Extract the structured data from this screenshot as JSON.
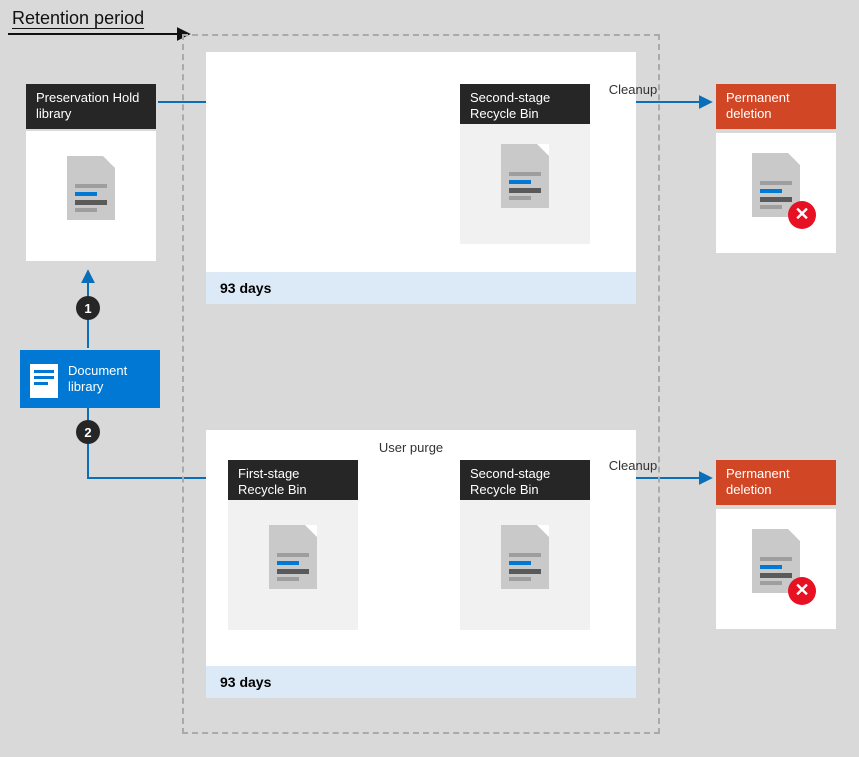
{
  "title": "Retention period",
  "source": {
    "preservationHold": "Preservation Hold library",
    "documentLibrary": "Document library"
  },
  "badges": {
    "one": "1",
    "two": "2"
  },
  "path1": {
    "secondStage": "Second-stage Recycle Bin",
    "cleanup": "Cleanup",
    "permanentDeletion": "Permanent deletion",
    "days": "93 days"
  },
  "path2": {
    "firstStage": "First-stage Recycle Bin",
    "userPurge": "User purge",
    "secondStage": "Second-stage Recycle Bin",
    "cleanup": "Cleanup",
    "permanentDeletion": "Permanent deletion",
    "days": "93 days"
  }
}
